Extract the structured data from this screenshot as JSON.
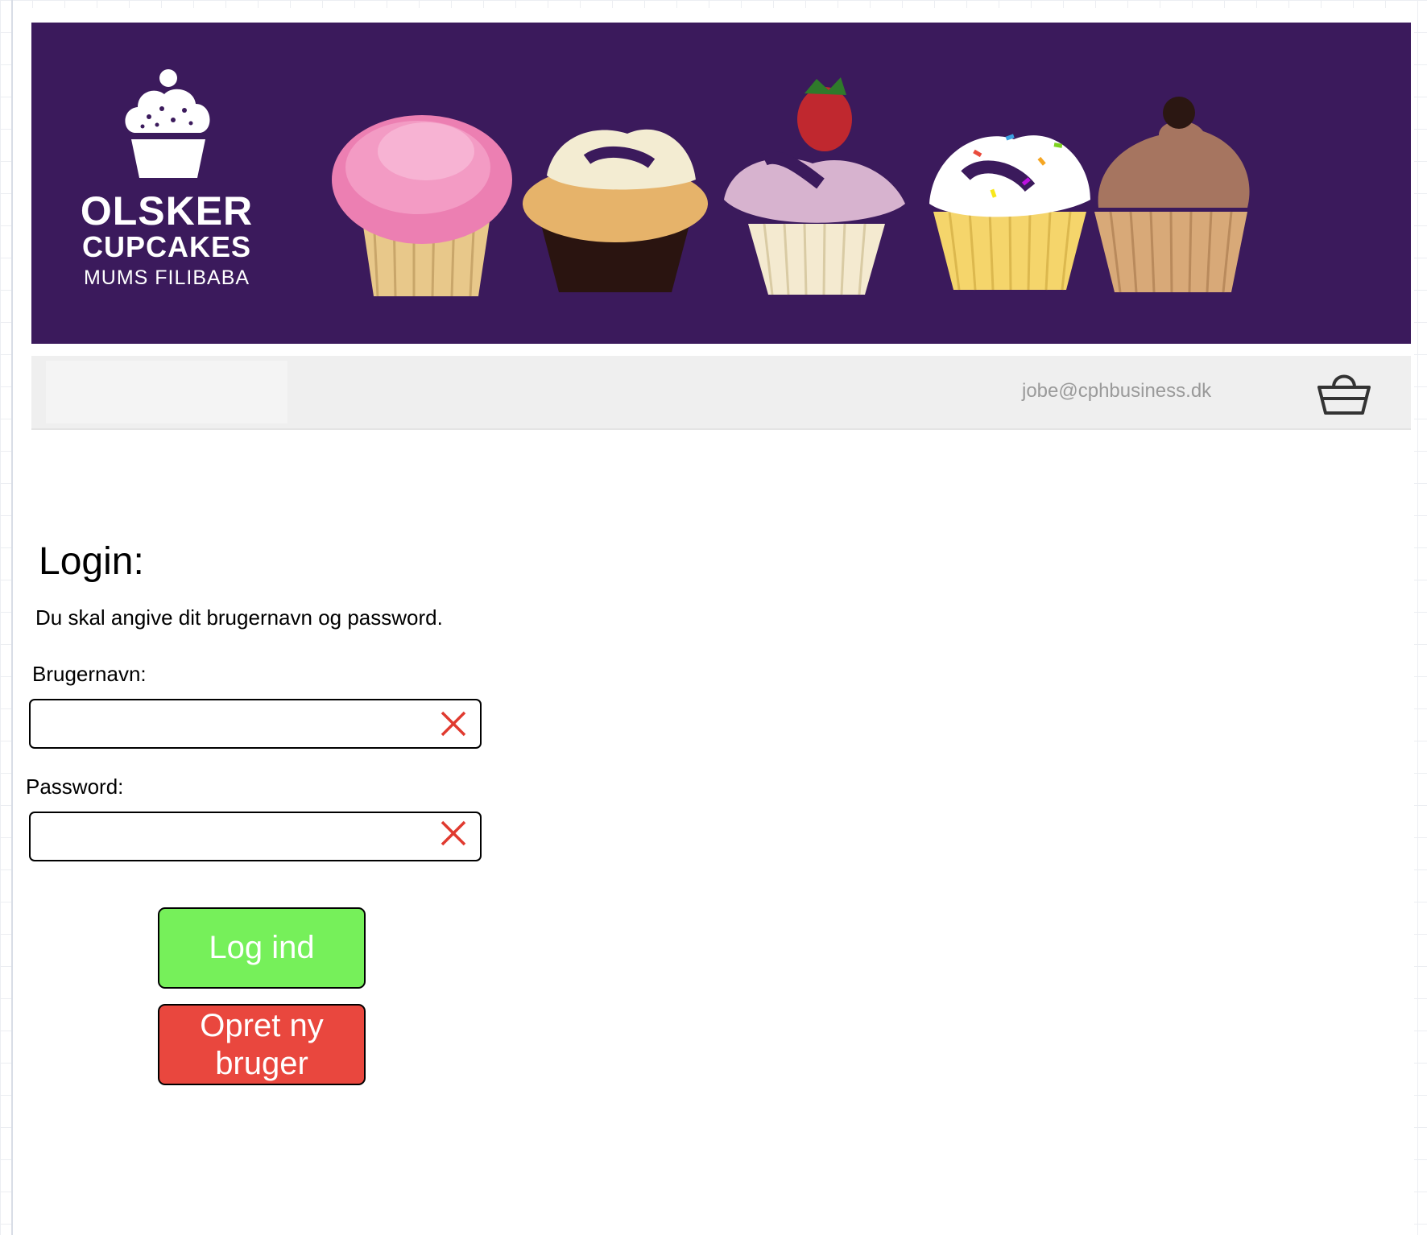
{
  "header": {
    "brand_line1": "OLSKER",
    "brand_line2": "CUPCAKES",
    "brand_line3": "MUMS FILIBABA",
    "colors": {
      "banner_bg": "#3b1a5c"
    }
  },
  "navbar": {
    "user_email": "jobe@cphbusiness.dk",
    "basket_icon": "basket-icon"
  },
  "login": {
    "title": "Login:",
    "description": "Du skal angive dit brugernavn og password.",
    "username_label": "Brugernavn:",
    "username_value": "",
    "password_label": "Password:",
    "password_value": "",
    "clear_icon": "close-icon",
    "login_button": "Log ind",
    "create_button_line1": "Opret ny",
    "create_button_line2": "bruger",
    "colors": {
      "login_button": "#76f05a",
      "create_button": "#e9473e",
      "clear_icon": "#e03a2f"
    }
  }
}
